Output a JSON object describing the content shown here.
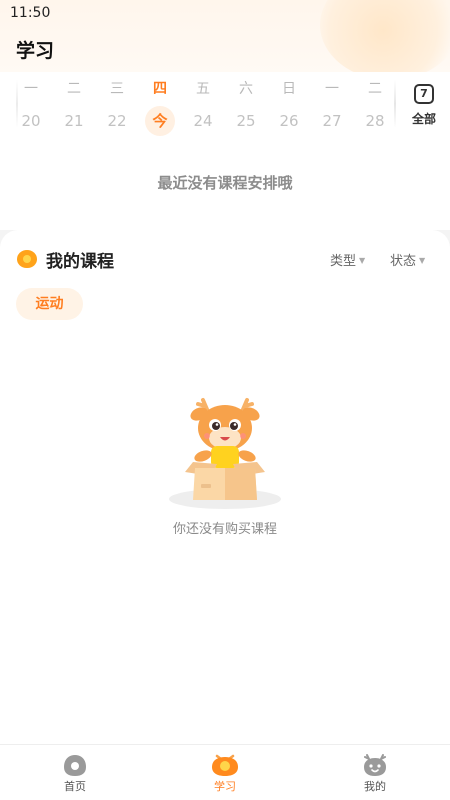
{
  "status_bar": {
    "time": "11:50"
  },
  "page": {
    "title": "学习"
  },
  "calendar": {
    "days": [
      {
        "weekday": "一",
        "date": "20"
      },
      {
        "weekday": "二",
        "date": "21"
      },
      {
        "weekday": "三",
        "date": "22"
      },
      {
        "weekday": "四",
        "date": "今"
      },
      {
        "weekday": "五",
        "date": "24"
      },
      {
        "weekday": "六",
        "date": "25"
      },
      {
        "weekday": "日",
        "date": "26"
      },
      {
        "weekday": "一",
        "date": "27"
      },
      {
        "weekday": "二",
        "date": "28"
      }
    ],
    "today_index": 3,
    "all_icon_text": "7",
    "all_label": "全部",
    "empty_text": "最近没有课程安排哦"
  },
  "courses": {
    "title": "我的课程",
    "filter_type": "类型",
    "filter_status": "状态",
    "tag": "运动",
    "empty_text": "你还没有购买课程"
  },
  "tabbar": {
    "tabs": [
      {
        "label": "首页",
        "icon": "home-icon"
      },
      {
        "label": "学习",
        "icon": "study-icon"
      },
      {
        "label": "我的",
        "icon": "profile-icon"
      }
    ],
    "active_index": 1
  },
  "colors": {
    "accent": "#ff7e21",
    "accent_light": "#fff3e6",
    "background": "#f4f4f4"
  }
}
